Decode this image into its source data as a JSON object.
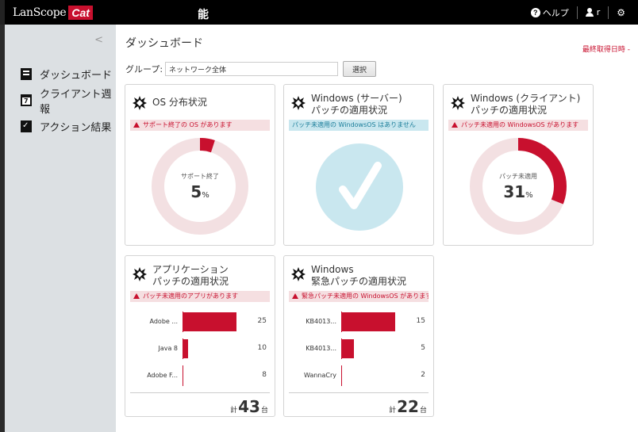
{
  "topbar": {
    "brand_text": "LanScope",
    "brand_cat": "Cat",
    "glyph": "能",
    "help_label": "ヘルプ",
    "user_label": "r"
  },
  "sidebar": {
    "items": [
      {
        "label": "ダッシュボード",
        "icon": "dashboard-icon"
      },
      {
        "label": "クライアント週報",
        "icon": "calendar-icon"
      },
      {
        "label": "アクション結果",
        "icon": "action-icon"
      }
    ]
  },
  "main": {
    "title": "ダッシュボード",
    "last_updated": "最終取得日時 -",
    "group_label": "グループ:",
    "group_value": "ネットワーク全体",
    "select_label": "選択"
  },
  "cards": {
    "os": {
      "title1": "OS 分布状況",
      "alert": "サポート終了の OS があります",
      "center_label": "サポート終了",
      "value": "5",
      "unit": "%",
      "percent": 5
    },
    "winserver": {
      "title1": "Windows (サーバー)",
      "title2": "パッチの適用状況",
      "alert": "パッチ未適用の WindowsOS はありません"
    },
    "winclient": {
      "title1": "Windows (クライアント)",
      "title2": "パッチの適用状況",
      "alert": "パッチ未適用の WindowsOS があります",
      "center_label": "パッチ未適用",
      "value": "31",
      "unit": "%",
      "percent": 31
    },
    "apps": {
      "title1": "アプリケーション",
      "title2": "パッチの適用状況",
      "alert": "パッチ未適用のアプリがあります",
      "rows": [
        {
          "label": "Adobe ...",
          "value": "25",
          "fraction": 1.0
        },
        {
          "label": "Java 8",
          "value": "10",
          "fraction": 0.11
        },
        {
          "label": "Adobe F...",
          "value": "8",
          "fraction": 0.0
        }
      ],
      "total_prefix": "計",
      "total": "43",
      "total_suffix": "台"
    },
    "urgent": {
      "title1": "Windows",
      "title2": "緊急パッチの適用状況",
      "alert": "緊急パッチ未適用の WindowsOS があります",
      "rows": [
        {
          "label": "KB4013...",
          "value": "15",
          "fraction": 1.0
        },
        {
          "label": "KB4013...",
          "value": "5",
          "fraction": 0.23
        },
        {
          "label": "WannaCry",
          "value": "2",
          "fraction": 0.0
        }
      ],
      "total_prefix": "計",
      "total": "22",
      "total_suffix": "台"
    }
  },
  "colors": {
    "accent": "#c8102e",
    "donut_track": "#f3e0e2",
    "check_bg": "#c9e7ef"
  }
}
